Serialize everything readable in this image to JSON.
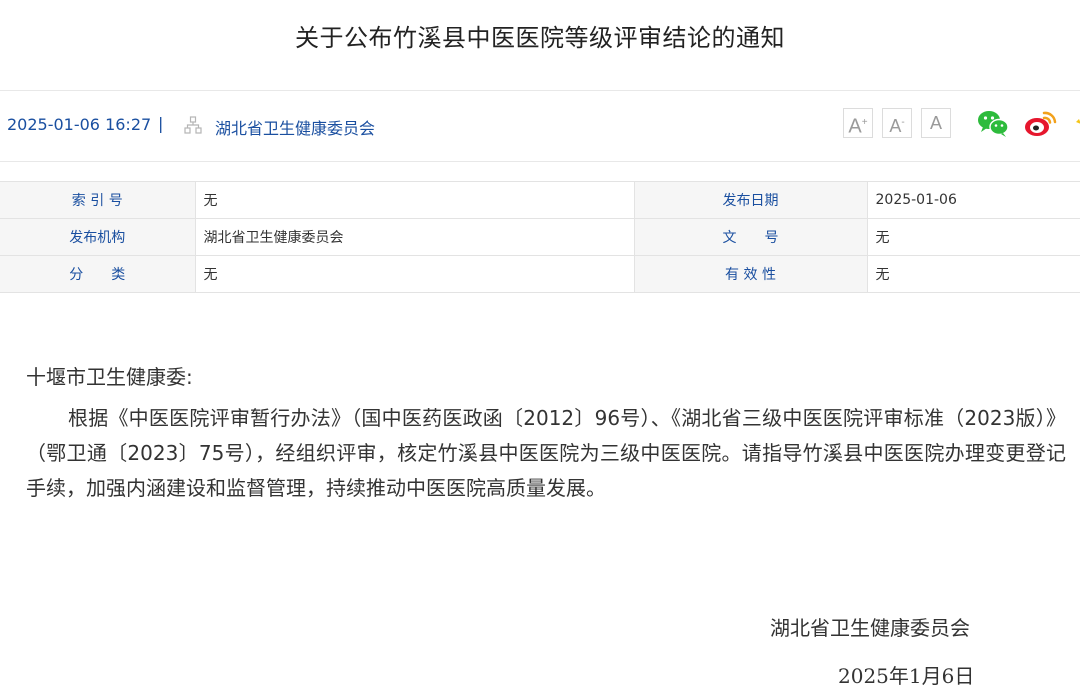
{
  "title": "关于公布竹溪县中医医院等级评审结论的通知",
  "info": {
    "datetime": "2025-01-06 16:27",
    "separator": "|",
    "org_icon": "sitemap-icon",
    "publisher": "湖北省卫生健康委员会"
  },
  "font_controls": {
    "increase": "A",
    "default": "A",
    "decrease": "A",
    "increase_sup": "+",
    "default_sup": "-"
  },
  "share": {
    "wechat_icon": "wechat-icon",
    "weibo_icon": "weibo-icon",
    "colors": {
      "wechat": "#2dbb3c",
      "weibo": "#f2a11c"
    }
  },
  "meta": {
    "index_label": "索 引 号",
    "index_value": "无",
    "date_label": "发布日期",
    "date_value": "2025-01-06",
    "org_label": "发布机构",
    "org_value": "湖北省卫生健康委员会",
    "docno_label": "文　　号",
    "docno_value": "无",
    "category_label": "分　　类",
    "category_value": "无",
    "validity_label": "有 效 性",
    "validity_value": "无"
  },
  "body": {
    "salutation": "十堰市卫生健康委:",
    "paragraph": "根据《中医医院评审暂行办法》（国中医药医政函〔2012〕96号）、《湖北省三级中医医院评审标准（2023版）》（鄂卫通〔2023〕75号），经组织评审，核定竹溪县中医医院为三级中医医院。请指导竹溪县中医医院办理变更登记手续，加强内涵建设和监督管理，持续推动中医医院高质量发展。"
  },
  "signature": {
    "org": "湖北省卫生健康委员会",
    "date": "2025年1月6日"
  },
  "colors": {
    "link_blue": "#1a4fa0",
    "label_bg": "#f6f6f6"
  }
}
